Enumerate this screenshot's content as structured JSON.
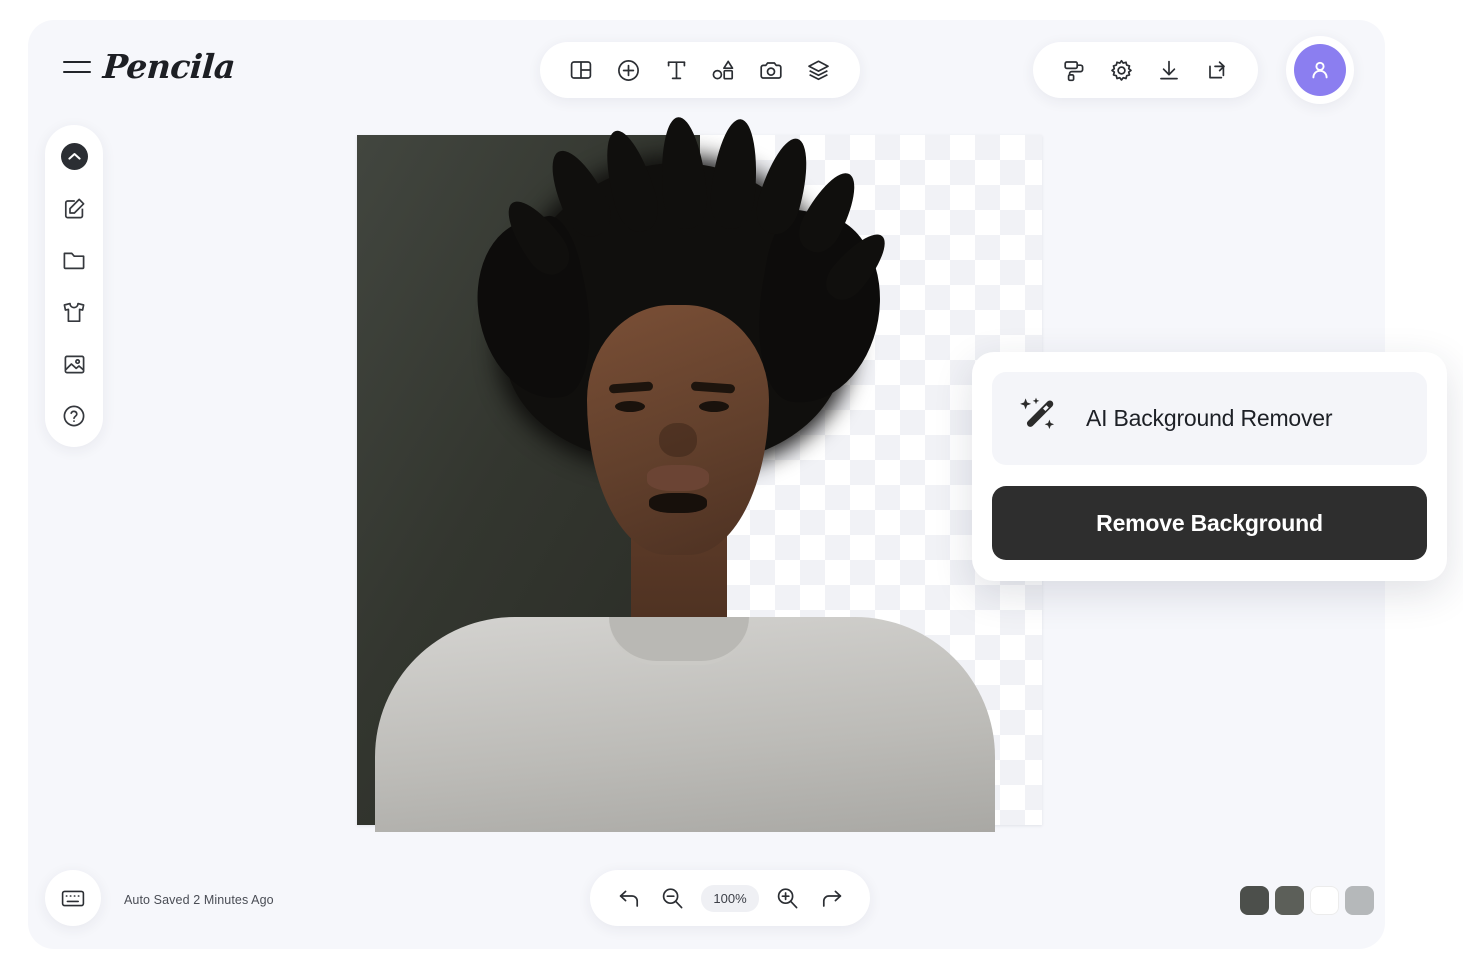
{
  "app": {
    "brand": "Pencila",
    "menu_icon": "hamburger-icon"
  },
  "center_toolbar": {
    "items": [
      {
        "name": "layout-panel-icon",
        "label": "Layout"
      },
      {
        "name": "plus-circle-icon",
        "label": "Add"
      },
      {
        "name": "text-tool-icon",
        "label": "Text"
      },
      {
        "name": "shapes-icon",
        "label": "Shapes"
      },
      {
        "name": "camera-icon",
        "label": "Camera"
      },
      {
        "name": "layers-icon",
        "label": "Layers"
      }
    ]
  },
  "right_toolbar": {
    "items": [
      {
        "name": "paint-roller-icon",
        "label": "Paint"
      },
      {
        "name": "gear-icon",
        "label": "Settings"
      },
      {
        "name": "download-icon",
        "label": "Download"
      },
      {
        "name": "share-icon",
        "label": "Share"
      }
    ],
    "avatar": {
      "name": "avatar",
      "color": "#8b7ef0",
      "icon": "user-icon"
    }
  },
  "sidebar": {
    "items": [
      {
        "name": "sidebar-collapse-toggle",
        "icon": "chevron-up-icon",
        "active": true
      },
      {
        "name": "sidebar-item-edit",
        "icon": "edit-square-icon",
        "active": false
      },
      {
        "name": "sidebar-item-folder",
        "icon": "folder-icon",
        "active": false
      },
      {
        "name": "sidebar-item-apparel",
        "icon": "tshirt-icon",
        "active": false
      },
      {
        "name": "sidebar-item-image",
        "icon": "image-icon",
        "active": false
      },
      {
        "name": "sidebar-item-help",
        "icon": "help-circle-icon",
        "active": false
      }
    ]
  },
  "canvas": {
    "name": "image-canvas",
    "photo_background": "#33362f",
    "checker_light": "#ffffff",
    "checker_dark": "#f1f2f6"
  },
  "panel": {
    "title": "AI Background Remover",
    "icon": "magic-wand-icon",
    "button_label": "Remove Background",
    "button_color": "#2e2e2e",
    "row_color": "#f4f5f9"
  },
  "bottom_bar": {
    "autosave_icon": "keyboard-icon",
    "autosave_text": "Auto Saved 2 Minutes Ago",
    "zoom": {
      "undo_icon": "undo-icon",
      "zoom_out_icon": "zoom-out-icon",
      "level": "100%",
      "zoom_in_icon": "zoom-in-icon",
      "redo_icon": "redo-icon"
    },
    "swatches": [
      {
        "name": "swatch-dark-gray",
        "color": "#4c4f4b"
      },
      {
        "name": "swatch-medium-gray",
        "color": "#5c5f59"
      },
      {
        "name": "swatch-white",
        "color": "#ffffff"
      },
      {
        "name": "swatch-light-gray",
        "color": "#b5b8ba"
      }
    ]
  }
}
